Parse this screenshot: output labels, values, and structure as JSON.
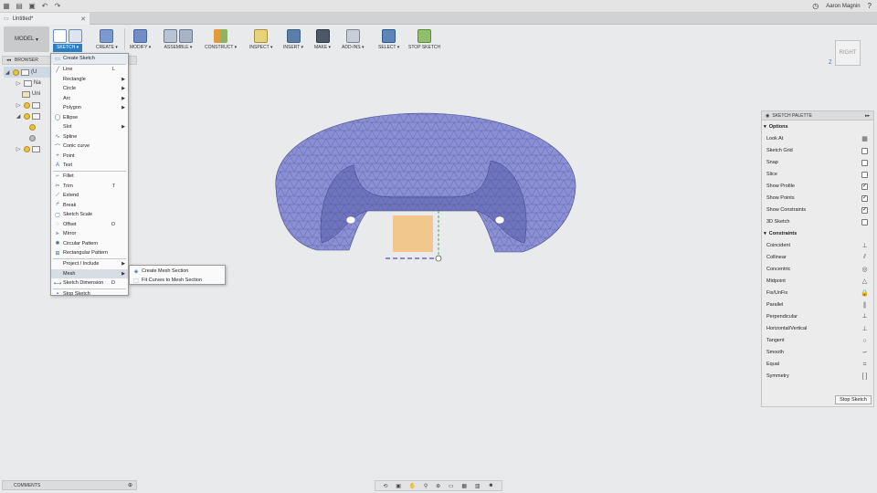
{
  "app_bar": {
    "user": "Aaron Magnin"
  },
  "doc_tab": {
    "title": "Untitled*"
  },
  "ribbon": {
    "model_label": "MODEL",
    "groups": [
      "SKETCH",
      "CREATE",
      "MODIFY",
      "ASSEMBLE",
      "CONSTRUCT",
      "INSPECT",
      "INSERT",
      "MAKE",
      "ADD-INS",
      "SELECT",
      "STOP SKETCH"
    ]
  },
  "browser": {
    "title": "BROWSER",
    "rows": [
      "(U",
      "Na",
      "Uni"
    ]
  },
  "sketch_menu": {
    "items": [
      {
        "label": "Create Sketch",
        "shortcut": "",
        "submenu": false
      },
      {
        "label": "Line",
        "shortcut": "L",
        "submenu": false
      },
      {
        "label": "Rectangle",
        "shortcut": "",
        "submenu": true
      },
      {
        "label": "Circle",
        "shortcut": "",
        "submenu": true
      },
      {
        "label": "Arc",
        "shortcut": "",
        "submenu": true
      },
      {
        "label": "Polygon",
        "shortcut": "",
        "submenu": true
      },
      {
        "label": "Ellipse",
        "shortcut": "",
        "submenu": false
      },
      {
        "label": "Slot",
        "shortcut": "",
        "submenu": true
      },
      {
        "label": "Spline",
        "shortcut": "",
        "submenu": false
      },
      {
        "label": "Conic curve",
        "shortcut": "",
        "submenu": false
      },
      {
        "label": "Point",
        "shortcut": "",
        "submenu": false
      },
      {
        "label": "Text",
        "shortcut": "",
        "submenu": false
      },
      {
        "label": "Fillet",
        "shortcut": "",
        "submenu": false
      },
      {
        "label": "Trim",
        "shortcut": "T",
        "submenu": false
      },
      {
        "label": "Extend",
        "shortcut": "",
        "submenu": false
      },
      {
        "label": "Break",
        "shortcut": "",
        "submenu": false
      },
      {
        "label": "Sketch Scale",
        "shortcut": "",
        "submenu": false
      },
      {
        "label": "Offset",
        "shortcut": "O",
        "submenu": false
      },
      {
        "label": "Mirror",
        "shortcut": "",
        "submenu": false
      },
      {
        "label": "Circular Pattern",
        "shortcut": "",
        "submenu": false
      },
      {
        "label": "Rectangular Pattern",
        "shortcut": "",
        "submenu": false
      },
      {
        "label": "Project / Include",
        "shortcut": "",
        "submenu": true
      },
      {
        "label": "Mesh",
        "shortcut": "",
        "submenu": true
      },
      {
        "label": "Sketch Dimension",
        "shortcut": "D",
        "submenu": false
      },
      {
        "label": "Stop Sketch",
        "shortcut": "",
        "submenu": false
      }
    ],
    "mesh_submenu": [
      "Create Mesh Section",
      "Fit Curves to Mesh Section"
    ]
  },
  "viewcube": {
    "face": "RIGHT",
    "axis": "Z"
  },
  "palette": {
    "title": "SKETCH PALETTE",
    "options_title": "Options",
    "options": [
      {
        "label": "Look At",
        "type": "icon",
        "checked": false
      },
      {
        "label": "Sketch Grid",
        "type": "check",
        "checked": false
      },
      {
        "label": "Snap",
        "type": "check",
        "checked": false
      },
      {
        "label": "Slice",
        "type": "check",
        "checked": false
      },
      {
        "label": "Show Profile",
        "type": "check",
        "checked": true
      },
      {
        "label": "Show Points",
        "type": "check",
        "checked": true
      },
      {
        "label": "Show Constraints",
        "type": "check",
        "checked": true
      },
      {
        "label": "3D Sketch",
        "type": "check",
        "checked": false
      }
    ],
    "constraints_title": "Constraints",
    "constraints": [
      "Coincident",
      "Collinear",
      "Concentric",
      "Midpoint",
      "Fix/UnFix",
      "Parallel",
      "Perpendicular",
      "Horizontal/Vertical",
      "Tangent",
      "Smooth",
      "Equal",
      "Symmetry"
    ],
    "stop_label": "Stop Sketch"
  },
  "comments": {
    "title": "COMMENTS"
  },
  "colors": {
    "accent": "#2d7fc1",
    "mesh": "#8a8fd6",
    "profile": "#f3c17c"
  }
}
